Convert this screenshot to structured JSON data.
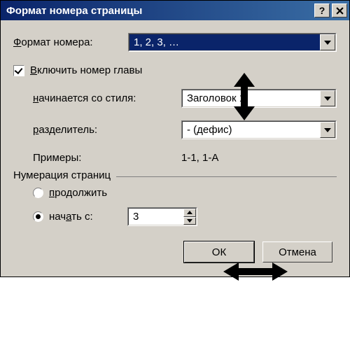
{
  "title": "Формат номера страницы",
  "format_label": "Формат номера:",
  "format_value": "1, 2, 3, …",
  "include_chapter_label": "Включить номер главы",
  "starts_with_style_label": "начинается со стиля:",
  "starts_with_style_value": "Заголовок 1",
  "separator_label": "разделитель:",
  "separator_value": "-    (дефис)",
  "examples_label": "Примеры:",
  "examples_value": "1-1, 1-A",
  "numbering_group": "Нумерация страниц",
  "continue_label": "продолжить",
  "start_from_label": "начать с:",
  "start_from_value": "3",
  "ok_label": "ОК",
  "cancel_label": "Отмена"
}
